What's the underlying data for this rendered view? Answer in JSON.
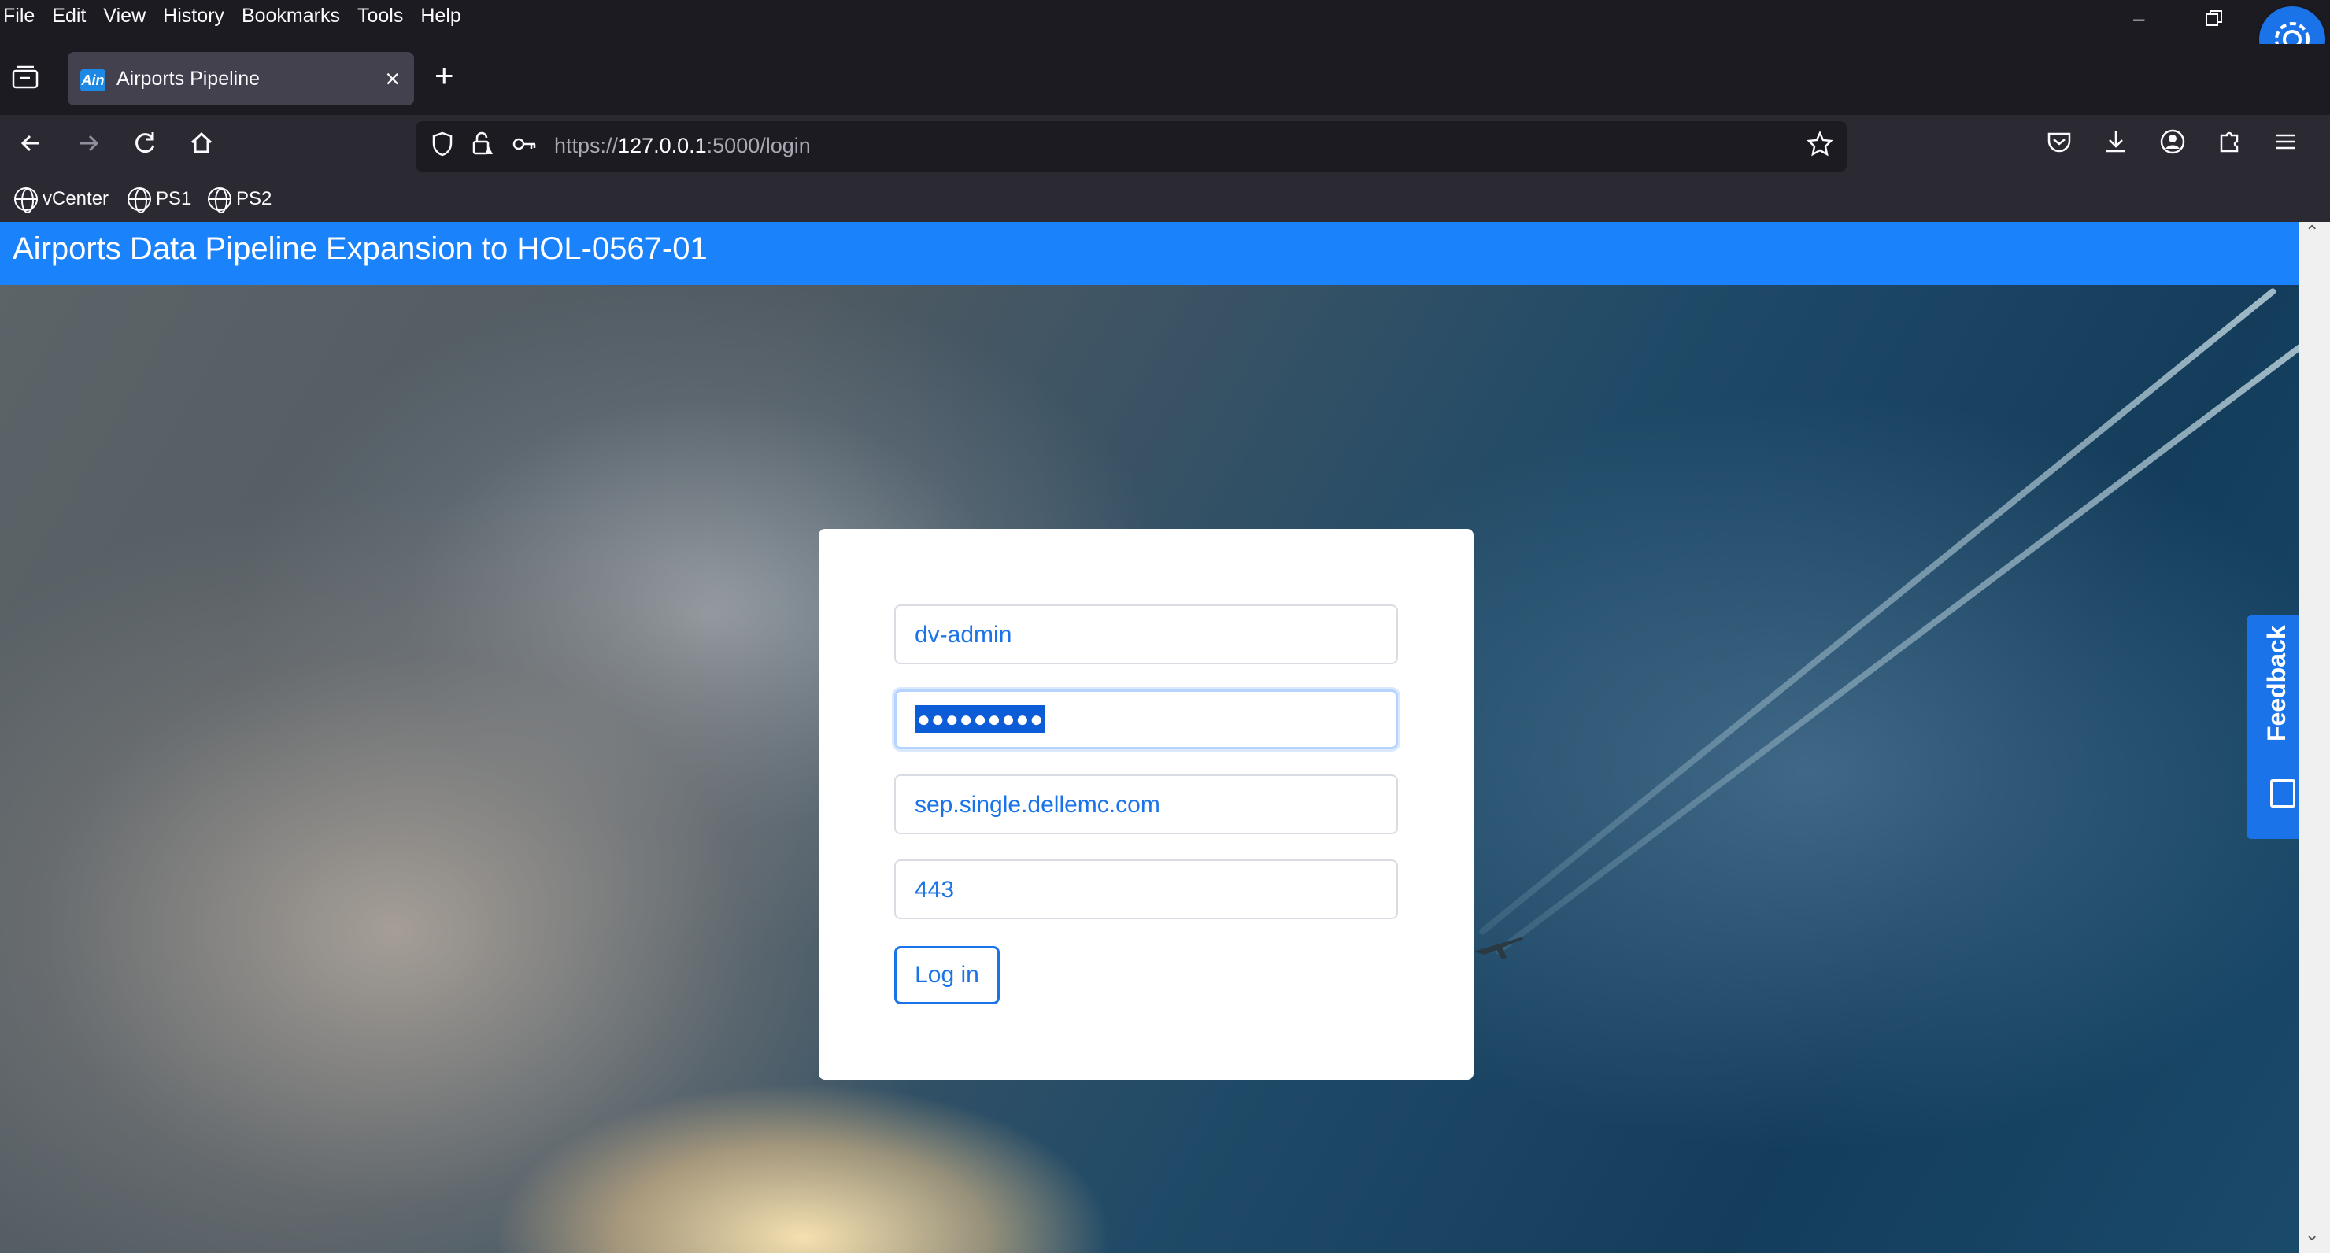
{
  "menubar": {
    "items": [
      "File",
      "Edit",
      "View",
      "History",
      "Bookmarks",
      "Tools",
      "Help"
    ]
  },
  "tab": {
    "favicon_text": "Ain",
    "title": "Airports Pipeline"
  },
  "urlbar": {
    "url_prefix": "https://",
    "url_host": "127.0.0.1",
    "url_rest": ":5000/login"
  },
  "bookmarks": [
    "vCenter",
    "PS1",
    "PS2"
  ],
  "page": {
    "header_title": "Airports Data Pipeline Expansion to HOL-0567-01"
  },
  "login": {
    "username": "dv-admin",
    "password_mask": "●●●●●●●●●",
    "host": "sep.single.dellemc.com",
    "port": "443",
    "button_label": "Log in"
  },
  "feedback": {
    "label": "Feedback"
  },
  "colors": {
    "header_blue": "#1a82fb",
    "link_blue": "#1a73e8",
    "browser_dark": "#1c1b22"
  }
}
